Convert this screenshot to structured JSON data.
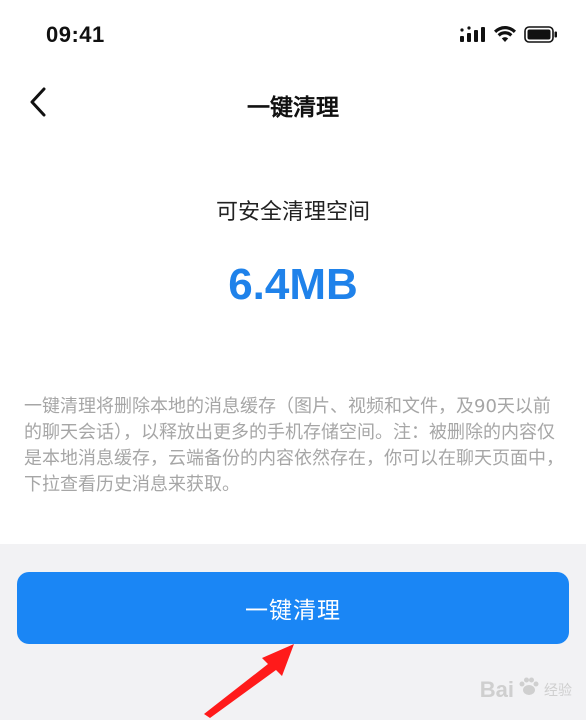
{
  "status_bar": {
    "time": "09:41",
    "icons": [
      "signal-icon",
      "wifi-icon",
      "battery-icon"
    ]
  },
  "nav": {
    "back_icon": "chevron-left-icon",
    "title": "一键清理"
  },
  "main": {
    "safe_label": "可安全清理空间",
    "size_value": "6.4MB",
    "description": "一键清理将删除本地的消息缓存（图片、视频和文件，及90天以前的聊天会话），以释放出更多的手机存储空间。注：被删除的内容仅是本地消息缓存，云端备份的内容依然存在，你可以在聊天页面中，下拉查看历史消息来获取。"
  },
  "action": {
    "button_label": "一键清理"
  },
  "watermark": {
    "brand": "Bai",
    "suffix": "经验"
  },
  "colors": {
    "accent": "#1a86f5",
    "size_text": "#1f82ea",
    "description_text": "#a6a6a6",
    "bottom_bg": "#f2f2f4",
    "arrow": "#ff1a1a"
  }
}
